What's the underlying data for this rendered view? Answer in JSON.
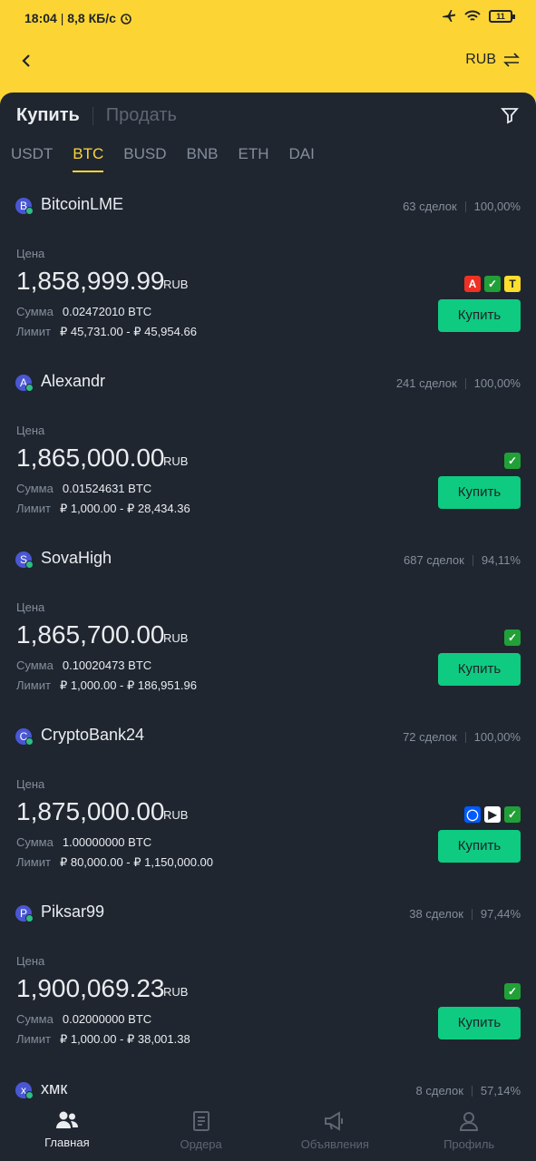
{
  "status": {
    "time": "18:04",
    "speed": "8,8 КБ/с",
    "battery": "11",
    "icons": [
      "alarm-icon",
      "airplane-icon",
      "wifi-icon"
    ]
  },
  "header": {
    "currency": "RUB"
  },
  "trade_tabs": {
    "buy": "Купить",
    "sell": "Продать"
  },
  "assets": [
    "USDT",
    "BTC",
    "BUSD",
    "BNB",
    "ETH",
    "DAI"
  ],
  "active_asset": "BTC",
  "labels": {
    "price": "Цена",
    "amount": "Сумма",
    "limit": "Лимит",
    "buy_button": "Купить"
  },
  "offers": [
    {
      "initial": "B",
      "name": "BitcoinLME",
      "deals": "63 сделок",
      "rate": "100,00%",
      "price": "1,858,999.99",
      "currency": "RUB",
      "amount": "0.02472010 BTC",
      "limit": "₽ 45,731.00 - ₽ 45,954.66",
      "payments": [
        "alfa",
        "sber",
        "tink"
      ]
    },
    {
      "initial": "A",
      "name": "Alexandr",
      "deals": "241 сделок",
      "rate": "100,00%",
      "price": "1,865,000.00",
      "currency": "RUB",
      "amount": "0.01524631 BTC",
      "limit": "₽ 1,000.00 - ₽ 28,434.36",
      "payments": [
        "sber"
      ]
    },
    {
      "initial": "S",
      "name": "SovaHigh",
      "deals": "687 сделок",
      "rate": "94,11%",
      "price": "1,865,700.00",
      "currency": "RUB",
      "amount": "0.10020473 BTC",
      "limit": "₽ 1,000.00 - ₽ 186,951.96",
      "payments": [
        "sber"
      ]
    },
    {
      "initial": "C",
      "name": "CryptoBank24",
      "deals": "72 сделок",
      "rate": "100,00%",
      "price": "1,875,000.00",
      "currency": "RUB",
      "amount": "1.00000000 BTC",
      "limit": "₽ 80,000.00 - ₽ 1,150,000.00",
      "payments": [
        "ozon",
        "gpay",
        "sber"
      ]
    },
    {
      "initial": "P",
      "name": "Piksar99",
      "deals": "38 сделок",
      "rate": "97,44%",
      "price": "1,900,069.23",
      "currency": "RUB",
      "amount": "0.02000000 BTC",
      "limit": "₽ 1,000.00 - ₽ 38,001.38",
      "payments": [
        "sber"
      ]
    },
    {
      "initial": "x",
      "name": "xмк",
      "deals": "8 сделок",
      "rate": "57,14%"
    }
  ],
  "nav": [
    {
      "label": "Главная",
      "icon": "users-icon",
      "active": true
    },
    {
      "label": "Ордера",
      "icon": "orders-icon",
      "active": false
    },
    {
      "label": "Объявления",
      "icon": "megaphone-icon",
      "active": false
    },
    {
      "label": "Профиль",
      "icon": "profile-icon",
      "active": false
    }
  ],
  "colors": {
    "accent": "#fcd535",
    "buy": "#0ecb81",
    "background": "#1f2630"
  }
}
